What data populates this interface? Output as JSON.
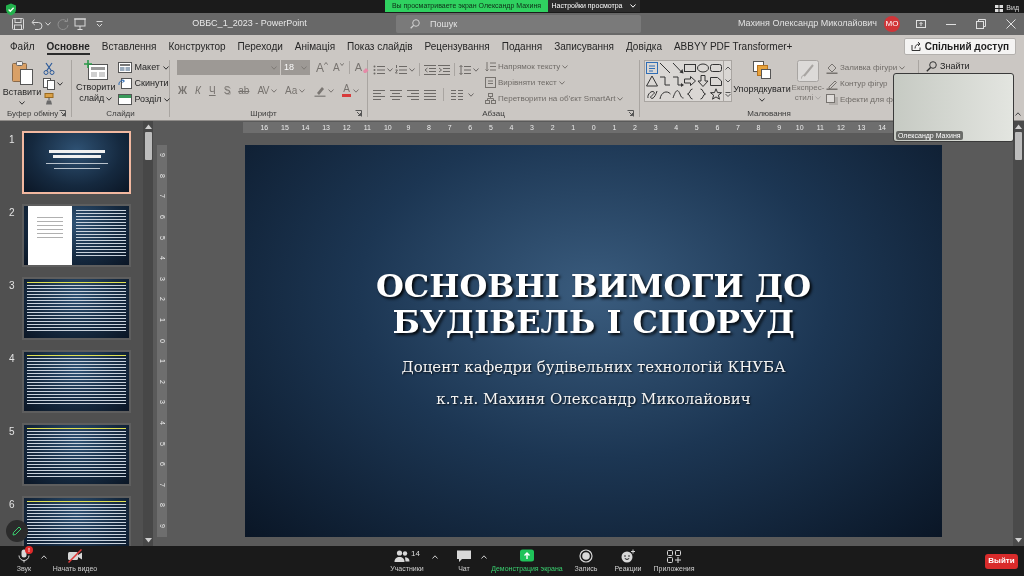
{
  "meeting_top_bar": {
    "sharing_banner": "Вы просматриваете экран Олександр Махиня",
    "view_settings_button": "Настройки просмотра",
    "view_button": "Вид"
  },
  "title_bar": {
    "document_title": "ОВБС_1_2023 - PowerPoint",
    "search": {
      "placeholder": "Пошук"
    },
    "user_name": "Махиня Олександр Миколайович",
    "user_initials": "МО"
  },
  "ribbon": {
    "tabs": [
      {
        "label": "Файл",
        "selected": false
      },
      {
        "label": "Основне",
        "selected": true
      },
      {
        "label": "Вставлення",
        "selected": false
      },
      {
        "label": "Конструктор",
        "selected": false
      },
      {
        "label": "Переходи",
        "selected": false
      },
      {
        "label": "Анімація",
        "selected": false
      },
      {
        "label": "Показ слайдів",
        "selected": false
      },
      {
        "label": "Рецензування",
        "selected": false
      },
      {
        "label": "Подання",
        "selected": false
      },
      {
        "label": "Записування",
        "selected": false
      },
      {
        "label": "Довідка",
        "selected": false
      },
      {
        "label": "ABBYY PDF Transformer+",
        "selected": false
      }
    ],
    "share_button": "Спільний доступ",
    "groups": [
      {
        "kind": "clipboard",
        "label": "Буфер обміну",
        "paste": "Вставити"
      },
      {
        "kind": "slides",
        "label": "Слайди",
        "new_slide": "Створити слайд",
        "commands": [
          {
            "label": "Макет",
            "menu": true
          },
          {
            "label": "Скинути",
            "menu": false
          },
          {
            "label": "Розділ",
            "menu": true
          }
        ]
      },
      {
        "kind": "font",
        "label": "Шрифт",
        "disabled": true,
        "font_size": "18",
        "grow": "A",
        "shrink": "A",
        "clear": "A",
        "styles": [
          {
            "kind": "bold",
            "label": "Ж",
            "menu": false
          },
          {
            "kind": "italic",
            "label": "К",
            "menu": false
          },
          {
            "kind": "underline",
            "label": "Ч",
            "menu": false
          },
          {
            "kind": "shadow",
            "label": "S",
            "menu": false
          },
          {
            "kind": "strike",
            "label": "ab",
            "menu": false
          },
          {
            "kind": "spacing",
            "label": "AV",
            "menu": true
          },
          {
            "kind": "case",
            "label": "Aa",
            "menu": true
          }
        ],
        "font_color": "A"
      },
      {
        "kind": "paragraph",
        "label": "Абзац",
        "commands": [
          {
            "label": "Напрямок тексту",
            "disabled": true,
            "menu": true
          },
          {
            "label": "Вирівняти текст",
            "disabled": true,
            "menu": true
          },
          {
            "label": "Перетворити на об’єкт SmartArt",
            "disabled": true,
            "menu": true
          }
        ]
      },
      {
        "kind": "drawing",
        "label": "Малювання",
        "arrange": {
          "label": "Упорядкувати",
          "disabled": false
        },
        "quick_styles": {
          "label": "Експрес-стилі",
          "disabled": true
        },
        "commands": [
          {
            "label": "Заливка фігури",
            "disabled": true,
            "menu": true
          },
          {
            "label": "Контур фігур",
            "disabled": true,
            "menu": false
          },
          {
            "label": "Ефекти для ф",
            "disabled": true,
            "menu": false
          }
        ]
      },
      {
        "kind": "editing",
        "commands": [
          {
            "label": "Знайти",
            "disabled": false,
            "menu": false
          }
        ]
      }
    ]
  },
  "thumbnails": [
    {
      "number": "1",
      "kind": "title",
      "selected": true
    },
    {
      "number": "2",
      "kind": "document",
      "selected": false
    },
    {
      "number": "3",
      "kind": "text",
      "selected": false
    },
    {
      "number": "4",
      "kind": "text",
      "selected": false
    },
    {
      "number": "5",
      "kind": "text",
      "selected": false
    },
    {
      "number": "6",
      "kind": "text",
      "selected": false
    }
  ],
  "horizontal_ruler": [
    "16",
    "15",
    "14",
    "13",
    "12",
    "11",
    "10",
    "9",
    "8",
    "7",
    "6",
    "5",
    "4",
    "3",
    "2",
    "1",
    "0",
    "1",
    "2",
    "3",
    "4",
    "5",
    "6",
    "7",
    "8",
    "9",
    "10",
    "11",
    "12",
    "13",
    "14"
  ],
  "vertical_ruler": [
    "9",
    "8",
    "7",
    "6",
    "5",
    "4",
    "3",
    "2",
    "1",
    "0",
    "1",
    "2",
    "3",
    "4",
    "5",
    "6",
    "7",
    "8",
    "9"
  ],
  "slide": {
    "title": "ОСНОВНІ ВИМОГИ ДО БУДІВЕЛЬ І СПОРУД",
    "subtitle": [
      "Доцент кафедри будівельних технологій КНУБА",
      "к.т.н. Махиня Олександр Миколайович"
    ]
  },
  "video": {
    "participant_name": "Олександр Махиня"
  },
  "meeting_controls": [
    {
      "kind": "mic",
      "label": "Звук",
      "badge": "!",
      "menu": true
    },
    {
      "kind": "video",
      "label": "Начать видео",
      "menu": false
    },
    {
      "kind": "participants",
      "label": "Участники",
      "count": "14",
      "menu": true
    },
    {
      "kind": "chat",
      "label": "Чат",
      "menu": true
    },
    {
      "kind": "share",
      "label": "Демонстрация экрана",
      "menu": false
    },
    {
      "kind": "record",
      "label": "Запись",
      "menu": false
    },
    {
      "kind": "reactions",
      "label": "Реакции",
      "menu": false
    },
    {
      "kind": "apps",
      "label": "Приложения",
      "menu": false
    }
  ],
  "leave_button": "Выйти"
}
